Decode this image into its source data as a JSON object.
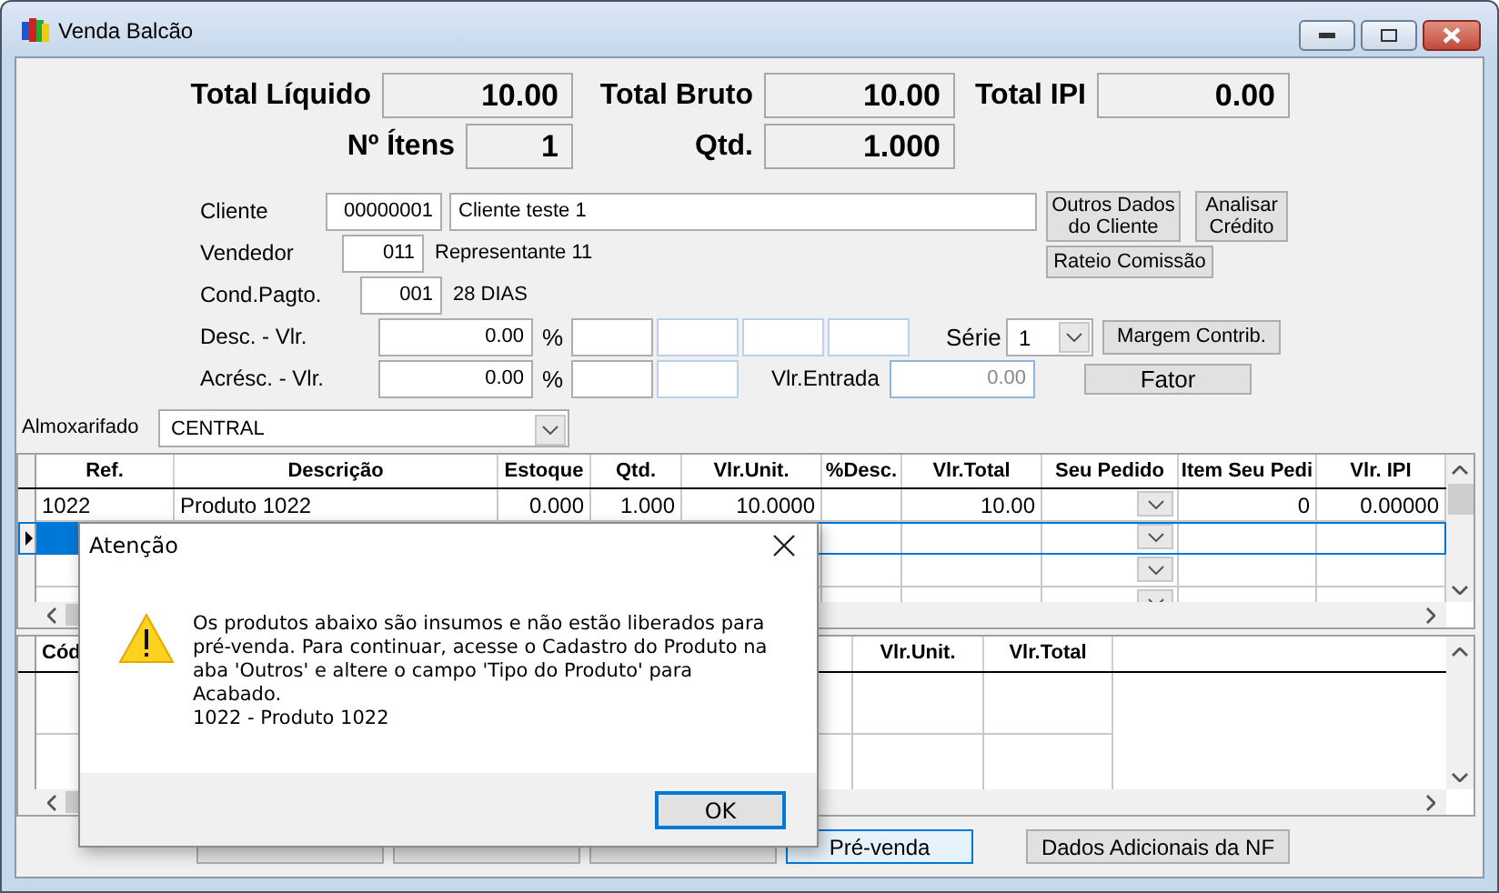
{
  "window": {
    "title": "Venda Balcão"
  },
  "totals": [
    [
      {
        "label": "Total Líquido",
        "value": "10.00"
      },
      {
        "label": "Total Bruto",
        "value": "10.00"
      },
      {
        "label": "Total IPI",
        "value": "0.00"
      }
    ],
    [
      {
        "label": "Nº Ítens",
        "value": "1"
      },
      {
        "label": "Qtd.",
        "value": "1.000"
      }
    ]
  ],
  "customer": [
    {
      "label": "Cliente",
      "code": "00000001",
      "name": "Cliente teste 1",
      "kind": "input"
    },
    {
      "label": "Vendedor",
      "code": "011",
      "name": "Representante 11",
      "kind": "text"
    },
    {
      "label": "Cond.Pagto.",
      "code": "001",
      "name": "28 DIAS",
      "kind": "text"
    }
  ],
  "customer_buttons": [
    "Outros Dados do Cliente",
    "Analisar Crédito",
    "Rateio Comissão"
  ],
  "discount": {
    "label": "Desc. - Vlr.",
    "value": "0.00",
    "percent": "%"
  },
  "surcharge": {
    "label": "Acrésc. - Vlr.",
    "value": "0.00",
    "percent": "%"
  },
  "serie": {
    "label": "Série",
    "value": "1"
  },
  "margin_button": "Margem Contrib.",
  "down_payment": {
    "label": "Vlr.Entrada",
    "value": "0.00",
    "disabled": true
  },
  "factor_button": "Fator",
  "warehouse": {
    "label": "Almoxarifado",
    "value": "CENTRAL"
  },
  "items_grid": {
    "columns": [
      {
        "label": "Ref.",
        "kind": "text"
      },
      {
        "label": "Descrição",
        "kind": "text"
      },
      {
        "label": "Estoque",
        "kind": "number"
      },
      {
        "label": "Qtd.",
        "kind": "number"
      },
      {
        "label": "Vlr.Unit.",
        "kind": "number"
      },
      {
        "label": "%Desc.",
        "kind": "number"
      },
      {
        "label": "Vlr.Total",
        "kind": "number"
      },
      {
        "label": "Seu Pedido",
        "kind": "combo"
      },
      {
        "label": "Item Seu Pedi",
        "kind": "number"
      },
      {
        "label": "Vlr. IPI",
        "kind": "number"
      }
    ],
    "rows": [
      {
        "selected": false,
        "cells": [
          {
            "text": "1022"
          },
          {
            "text": "Produto 1022"
          },
          {
            "text": "0.000"
          },
          {
            "text": "1.000"
          },
          {
            "text": "10.0000"
          },
          {},
          {
            "text": "10.00"
          },
          {},
          {
            "text": "0"
          },
          {
            "text": "0.00000"
          }
        ]
      },
      {
        "selected": true
      },
      {
        "selected": false
      },
      {
        "selected": false
      }
    ]
  },
  "detail_grid": {
    "columns": [
      {
        "label": "Cód"
      },
      {
        "label": "Vlr.Unit."
      },
      {
        "label": "Vlr.Total"
      }
    ],
    "rows": [
      {
        "selected": false
      },
      {
        "selected": false
      }
    ]
  },
  "actions": [
    {
      "focused": false
    },
    {
      "focused": false
    },
    {
      "focused": false
    },
    {
      "label": "Pré-venda",
      "focused": true
    },
    {
      "label": "Dados Adicionais da NF",
      "focused": false
    }
  ],
  "dialog": {
    "title": "Atenção",
    "message": "Os produtos abaixo são insumos e não estão liberados para pré-venda. Para continuar, acesse o Cadastro do Produto na aba 'Outros' e altere o campo 'Tipo do Produto' para Acabado.",
    "items": [
      "1022 - Produto 1022"
    ],
    "button": {
      "label": "OK",
      "default": true
    }
  }
}
